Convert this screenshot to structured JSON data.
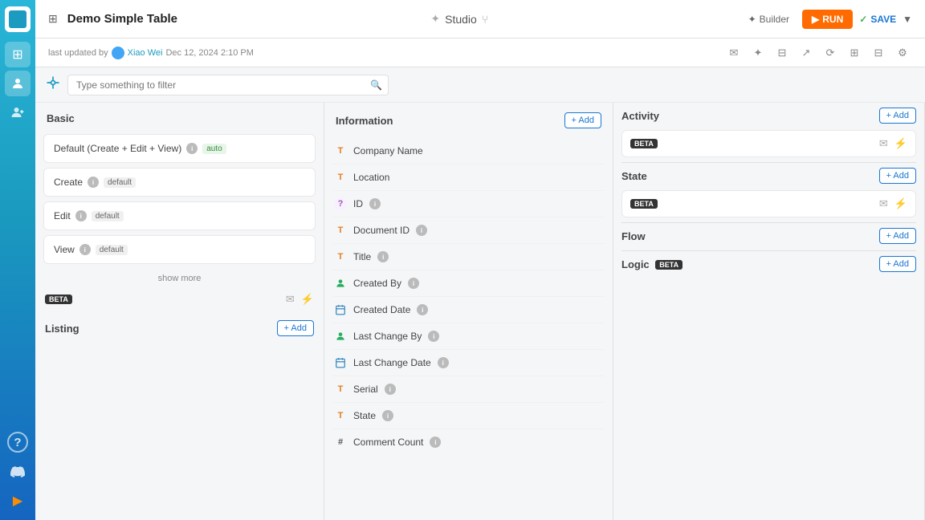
{
  "sidebar": {
    "items": [
      {
        "name": "home",
        "icon": "⊞",
        "active": false
      },
      {
        "name": "users",
        "icon": "👤",
        "active": true
      },
      {
        "name": "user-plus",
        "icon": "👥",
        "active": false
      }
    ],
    "bottom_items": [
      {
        "name": "help",
        "icon": "?"
      },
      {
        "name": "discord",
        "icon": "◉"
      },
      {
        "name": "cursor",
        "icon": "▶"
      }
    ]
  },
  "topbar": {
    "icon": "⊞",
    "title": "Demo Simple Table",
    "studio_label": "Studio",
    "builder_label": "Builder",
    "run_label": "RUN",
    "save_label": "SAVE"
  },
  "subbar": {
    "prefix": "last updated by",
    "user": "Xiao Wei",
    "date": "Dec 12, 2024 2:10 PM",
    "icons": [
      "✉",
      "✦",
      "⊟",
      "✦",
      "⟳",
      "⊟",
      "⊟",
      "✦"
    ]
  },
  "filterbar": {
    "placeholder": "Type something to filter"
  },
  "basic_panel": {
    "title": "Basic",
    "items": [
      {
        "label": "Default (Create + Edit + View)",
        "badge": "auto",
        "has_info": true
      },
      {
        "label": "Create",
        "badge": "default",
        "has_info": true
      },
      {
        "label": "Edit",
        "badge": "default",
        "has_info": true
      },
      {
        "label": "View",
        "badge": "default",
        "has_info": true
      }
    ],
    "show_more": "show more",
    "beta_label": "BETA",
    "listing_title": "Listing",
    "listing_add": "+ Add"
  },
  "information_panel": {
    "title": "Information",
    "add_label": "+ Add",
    "fields": [
      {
        "type": "T",
        "name": "Company Name",
        "has_info": false
      },
      {
        "type": "T",
        "name": "Location",
        "has_info": false
      },
      {
        "type": "Q",
        "name": "ID",
        "has_info": true
      },
      {
        "type": "T",
        "name": "Document ID",
        "has_info": true
      },
      {
        "type": "T",
        "name": "Title",
        "has_info": true
      },
      {
        "type": "person",
        "name": "Created By",
        "has_info": true
      },
      {
        "type": "date",
        "name": "Created Date",
        "has_info": true
      },
      {
        "type": "person",
        "name": "Last Change By",
        "has_info": true
      },
      {
        "type": "date",
        "name": "Last Change Date",
        "has_info": true
      },
      {
        "type": "T",
        "name": "Serial",
        "has_info": true
      },
      {
        "type": "T",
        "name": "State",
        "has_info": true
      },
      {
        "type": "hash",
        "name": "Comment Count",
        "has_info": true
      }
    ]
  },
  "activity_panel": {
    "title": "Activity",
    "add_label": "+ Add",
    "beta_label": "BETA",
    "state_title": "State",
    "state_add_label": "+ Add",
    "state_beta_label": "BETA",
    "flow_title": "Flow",
    "flow_add_label": "+ Add",
    "logic_title": "Logic",
    "logic_beta_label": "BETA",
    "logic_add_label": "+ Add"
  }
}
